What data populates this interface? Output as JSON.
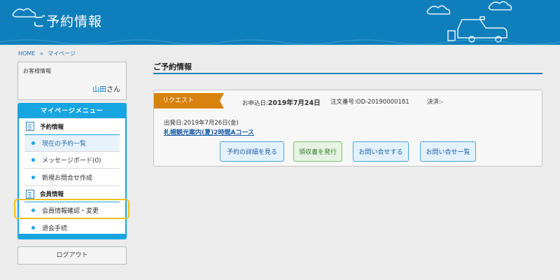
{
  "header": {
    "title": "ご予約情報"
  },
  "breadcrumb": {
    "home": "HOME",
    "sep": "»",
    "current": "マイページ"
  },
  "customer": {
    "label": "お客様情報",
    "name": "山田",
    "suffix": "さん"
  },
  "menu": {
    "title": "マイページメニュー",
    "section1": "予約情報",
    "item_list": "現在の予約一覧",
    "item_message": "メッセージボード(0)",
    "item_inquiry": "新規お問合せ作成",
    "section2": "会員情報",
    "item_member": "会員情報確認・変更",
    "item_withdraw": "退会手続"
  },
  "logout": "ログアウト",
  "main": {
    "title": "ご予約情報",
    "status": "リクエスト",
    "apply_label": "お申込日:",
    "apply_date": "2019年7月24日",
    "order_label": "注文番号:",
    "order_no": "OD-20190000181",
    "payment": "決済:-",
    "depart": "出発日:2019年7月26日(金)",
    "tour": "札幌観光案内(夏)2時間Aコース",
    "buttons": {
      "detail": "予約の詳細を見る",
      "receipt": "領収書を発行",
      "contact": "お問い合せする",
      "contact_list": "お問い合せ一覧"
    }
  },
  "colors": {
    "header": "#0f7fbb",
    "accent": "#16a5e0",
    "status": "#d9820f",
    "highlight": "#f5c01e"
  }
}
